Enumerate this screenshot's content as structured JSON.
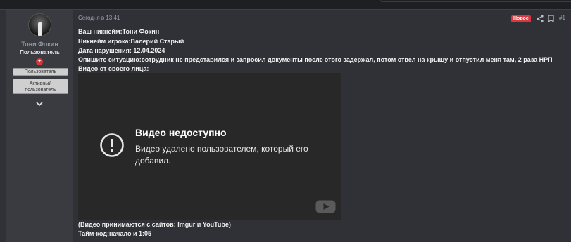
{
  "user": {
    "name": "Тони Фокин",
    "title": "Пользователь",
    "banners": [
      "Пользователь",
      "Активный пользователь"
    ]
  },
  "post": {
    "date": "Сегодня в 13:41",
    "badge": "Новое",
    "number": "#1",
    "lines": [
      "Ваш никнейм:Тони Фокин",
      "Никнейм игрока:Валерий Старый",
      "Дата нарушения: 12.04.2024",
      "Опишите ситуацию:сотрудник не представился и запросил документы после этого задержал, потом отвел на крышу и отпустил меня там, 2 раза НРП",
      "Видео от своего лица:"
    ],
    "footer_lines": [
      "(Видео принимаются с сайтов: Imgur и YouTube)",
      "Тайм-код:начало и 1:05"
    ]
  },
  "video": {
    "title": "Видео недоступно",
    "message": "Видео удалено пользователем, который его добавил."
  },
  "colors": {
    "badge": "#d9363e",
    "page_bg": "#2f3136",
    "sidebar_bg": "#393b41",
    "video_bg": "#282828"
  },
  "icons": [
    "share-icon",
    "bookmark-icon",
    "chevron-down-icon",
    "alert-icon",
    "youtube-icon"
  ]
}
